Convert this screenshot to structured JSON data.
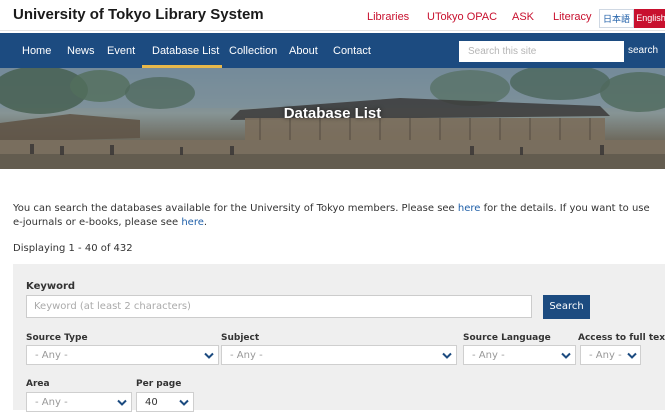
{
  "topbar": {
    "site_title": "University of Tokyo Library System",
    "links": [
      "Libraries",
      "UTokyo OPAC",
      "ASK",
      "Literacy"
    ],
    "lang_ja": "日本語",
    "lang_en": "English"
  },
  "nav": {
    "items": [
      "Home",
      "News",
      "Event",
      "Database List",
      "Collection",
      "About",
      "Contact"
    ],
    "active": "Database List",
    "search_placeholder": "Search this site",
    "search_label": "search"
  },
  "hero": {
    "title": "Database List"
  },
  "intro": {
    "text_a": "You can search the databases available for the University of Tokyo members. Please see ",
    "link_a": "here",
    "text_b": " for the details. If you want to use e-journals or e-books, please see ",
    "link_b": "here",
    "text_c": "."
  },
  "results": {
    "displaying": "Displaying 1 - 40 of 432"
  },
  "search_form": {
    "keyword_label": "Keyword",
    "keyword_placeholder": "Keyword (at least 2 characters)",
    "search_button": "Search",
    "source_type": {
      "label": "Source Type",
      "value": "- Any -"
    },
    "subject": {
      "label": "Subject",
      "value": "- Any -"
    },
    "source_language": {
      "label": "Source Language",
      "value": "- Any -"
    },
    "access": {
      "label": "Access to full text",
      "value": "- Any -"
    },
    "area": {
      "label": "Area",
      "value": "- Any -"
    },
    "per_page": {
      "label": "Per page",
      "value": "40"
    }
  },
  "colors": {
    "nav_blue": "#1c4b80",
    "accent_red": "#c8102e",
    "active_underline": "#e8b84a",
    "link_blue": "#1f5fa8"
  },
  "icons": {
    "dropdown": "chevron-down-icon"
  }
}
